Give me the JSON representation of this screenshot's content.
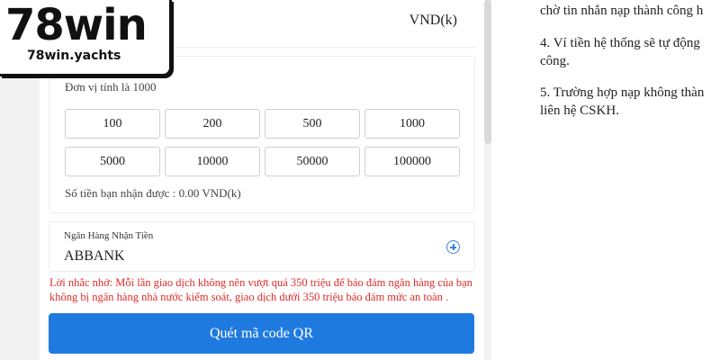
{
  "logo": {
    "main": "78win",
    "domain": "78win.yachts"
  },
  "deposit": {
    "currency": "VND(k)",
    "unit_note": "Đơn vị tính là 1000",
    "amounts": [
      "100",
      "200",
      "500",
      "1000",
      "5000",
      "10000",
      "50000",
      "100000"
    ],
    "received": "Số tiền bạn nhận được : 0.00 VND(k)"
  },
  "bank": {
    "label": "Ngân Hàng Nhận Tiền",
    "value": "ABBANK"
  },
  "warning": "Lời nhắc nhở: Mỗi lần giao dịch không nên vượt quá 350 triệu để bảo đảm ngân hàng của bạn không bị ngân hàng nhà nước kiểm soát, giao dịch dưới 350 triệu bảo đảm mức an toàn .",
  "qr_button": "Quét mã code QR",
  "instructions": {
    "line0": "chờ tin nhắn nạp thành công h",
    "item4_line1": "4. Ví tiền hệ thống sẽ tự động",
    "item4_line2": "công.",
    "item5_line1": "5. Trường hợp nạp không thàn",
    "item5_line2": "liên hệ CSKH."
  },
  "colors": {
    "accent": "#1f7ae0",
    "warning": "#e02b2b",
    "icon": "#3b82d6"
  }
}
